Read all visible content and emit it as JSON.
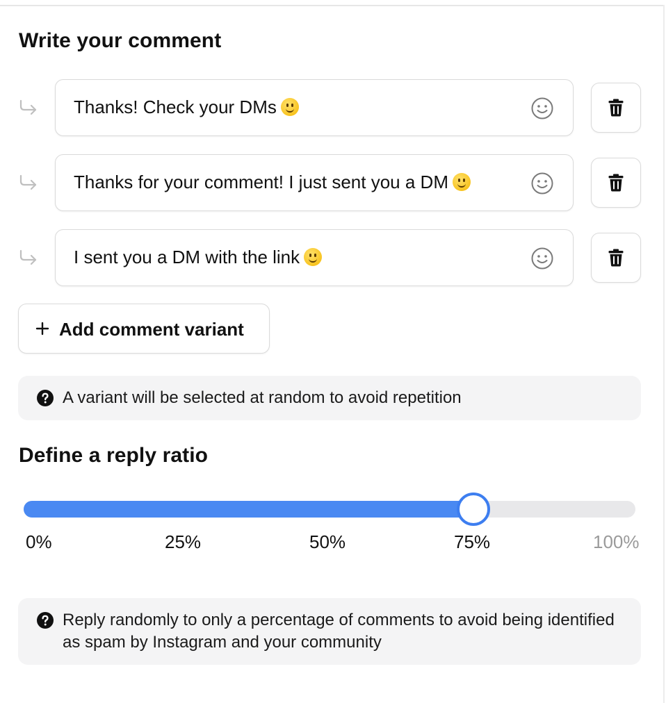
{
  "comment_section": {
    "title": "Write your comment",
    "variants": [
      {
        "text": "Thanks! Check your DMs",
        "emoji": "slightly-smiling-face"
      },
      {
        "text": "Thanks for your comment! I just sent you a DM",
        "emoji": "slightly-smiling-face"
      },
      {
        "text": "I sent you a DM with the link",
        "emoji": "slightly-smiling-face"
      }
    ],
    "add_button_label": "Add comment variant",
    "info_text": "A variant will be selected at random to avoid repetition"
  },
  "ratio_section": {
    "title": "Define a reply ratio",
    "slider": {
      "value_percent": 73.5,
      "fill_color": "#4a89f2",
      "track_color": "#e8e8ea"
    },
    "ticks": [
      "0%",
      "25%",
      "50%",
      "75%",
      "100%"
    ],
    "info_text": "Reply randomly to only a percentage of comments to avoid being identified as spam by Instagram and your community"
  },
  "icons": {
    "reply": "reply-arrow-icon",
    "emoji_picker": "smiley-icon",
    "delete": "trash-icon",
    "add": "plus-icon",
    "help": "question-circle-icon"
  }
}
